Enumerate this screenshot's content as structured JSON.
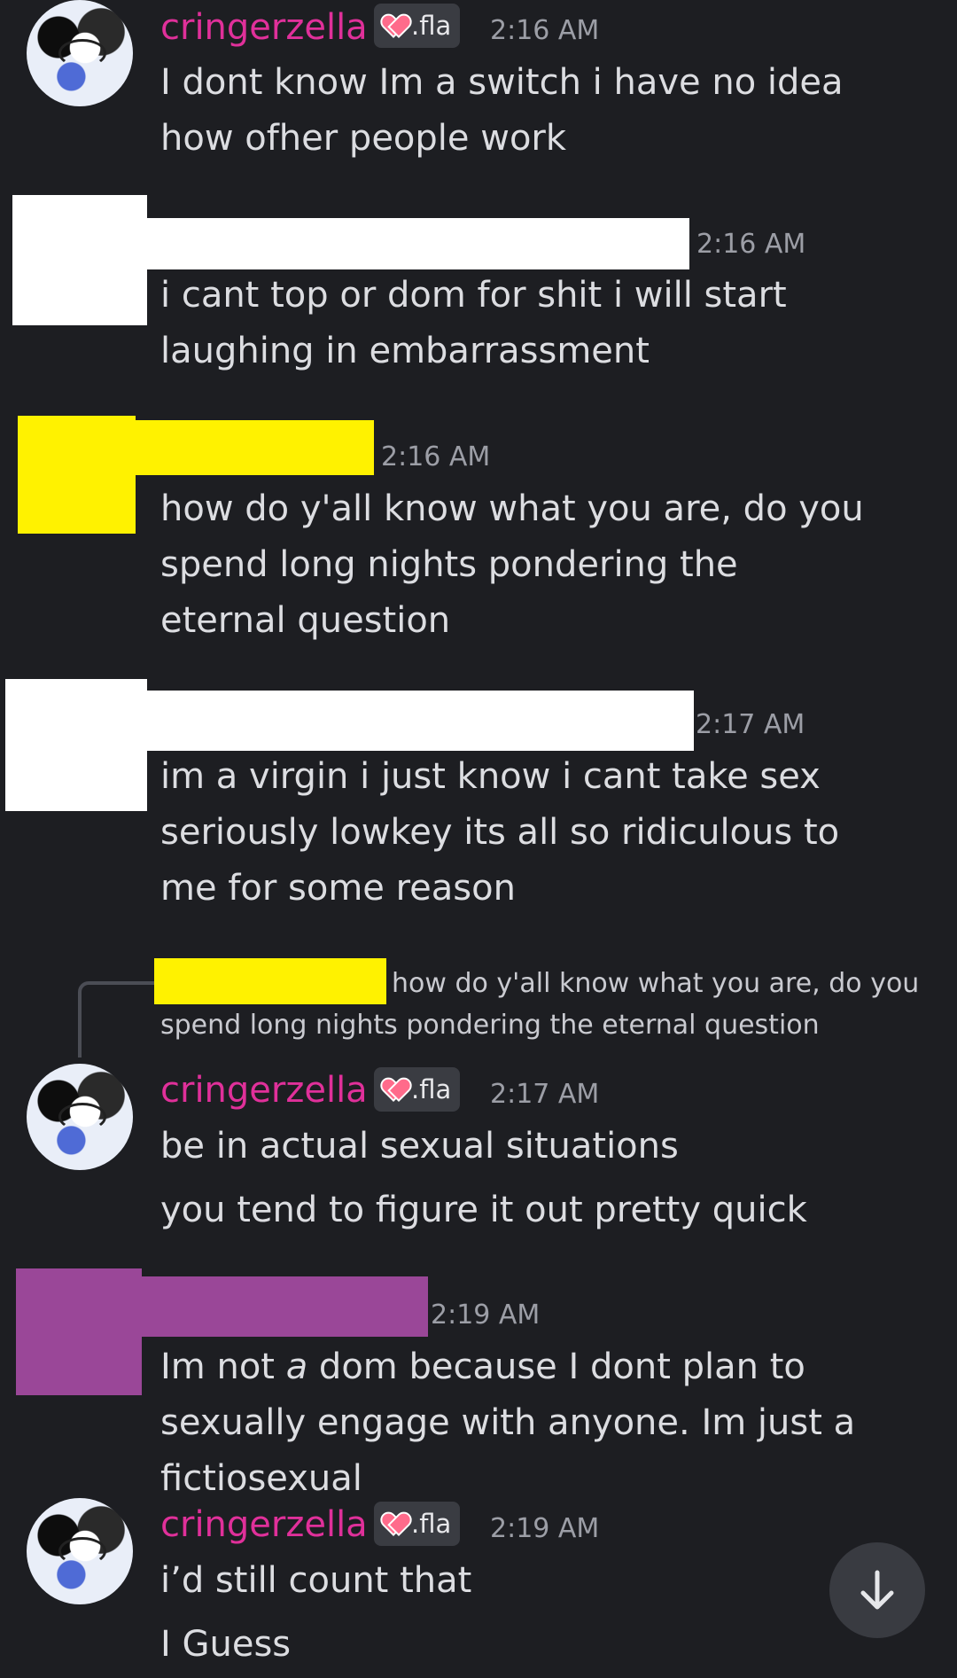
{
  "messages": {
    "m1": {
      "username": "cringerzella",
      "tag": ".fla",
      "time": "2:16 AM",
      "text": "I dont know Im a switch i have no idea how ofher people work"
    },
    "m2": {
      "time": "2:16 AM",
      "text": "i cant top or dom for shit i will start laughing in embarrassment"
    },
    "m3": {
      "time": "2:16 AM",
      "text": "how do y'all know what you are, do you spend long nights pondering the eternal question"
    },
    "m4": {
      "time": "2:17 AM",
      "text": "im a virgin i just know i cant take sex seriously lowkey its all so ridiculous to me for some reason"
    },
    "reply": {
      "text_line1": "how do y'all know what you are, do you",
      "text_line2": "spend long nights pondering the eternal question"
    },
    "m5": {
      "username": "cringerzella",
      "tag": ".fla",
      "time": "2:17 AM",
      "text": "be in actual sexual situations",
      "text2": "you tend to figure it out pretty quick"
    },
    "m6": {
      "time": "2:19 AM",
      "text_before": "Im not ",
      "text_em": "a",
      "text_after": " dom because I dont plan to sexually engage with anyone. Im just a fictiosexual"
    },
    "m7": {
      "username": "cringerzella",
      "tag": ".fla",
      "time": "2:19 AM",
      "text": "i’d still count that",
      "text2": "I Guess"
    }
  },
  "colors": {
    "background": "#1d1e22",
    "username": "#e0309a",
    "timestamp": "#9c9ea6",
    "redact_yellow": "#fff200",
    "redact_purple": "#9a4798"
  },
  "icons": {
    "scroll_down": "arrow-down-icon"
  }
}
